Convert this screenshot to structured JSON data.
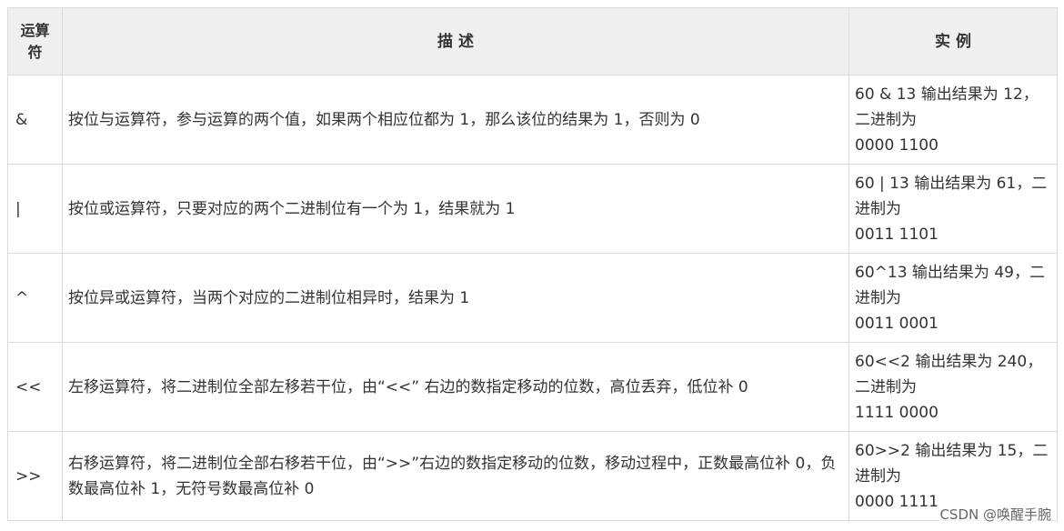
{
  "table": {
    "headers": {
      "op": [
        "运算",
        "符"
      ],
      "desc": "描 述",
      "ex": "实 例"
    },
    "rows": [
      {
        "op": "&",
        "desc": "按位与运算符，参与运算的两个值，如果两个相应位都为 1，那么该位的结果为 1，否则为 0",
        "ex": [
          "60 & 13 输出结果为 12，",
          "二进制为",
          "0000 1100"
        ]
      },
      {
        "op": "|",
        "desc": "按位或运算符，只要对应的两个二进制位有一个为 1，结果就为 1",
        "ex": [
          "60 | 13 输出结果为 61，二",
          "进制为",
          "0011 1101"
        ]
      },
      {
        "op": "^",
        "desc": "按位异或运算符，当两个对应的二进制位相异时，结果为 1",
        "ex": [
          "60^13 输出结果为 49，二",
          "进制为",
          "0011 0001"
        ]
      },
      {
        "op": "<<",
        "desc": "左移运算符，将二进制位全部左移若干位，由“<<” 右边的数指定移动的位数，高位丢弃，低位补 0",
        "ex": [
          "60<<2 输出结果为 240，",
          "二进制为",
          "1111 0000"
        ]
      },
      {
        "op": ">>",
        "desc": "右移运算符，将二进制位全部右移若干位，由“>>”右边的数指定移动的位数，移动过程中，正数最高位补 0，负数最高位补 1，无符号数最高位补 0",
        "ex": [
          "60>>2 输出结果为 15，二",
          "进制为",
          "0000 1111"
        ]
      }
    ]
  },
  "watermark": "CSDN @唤醒手腕"
}
